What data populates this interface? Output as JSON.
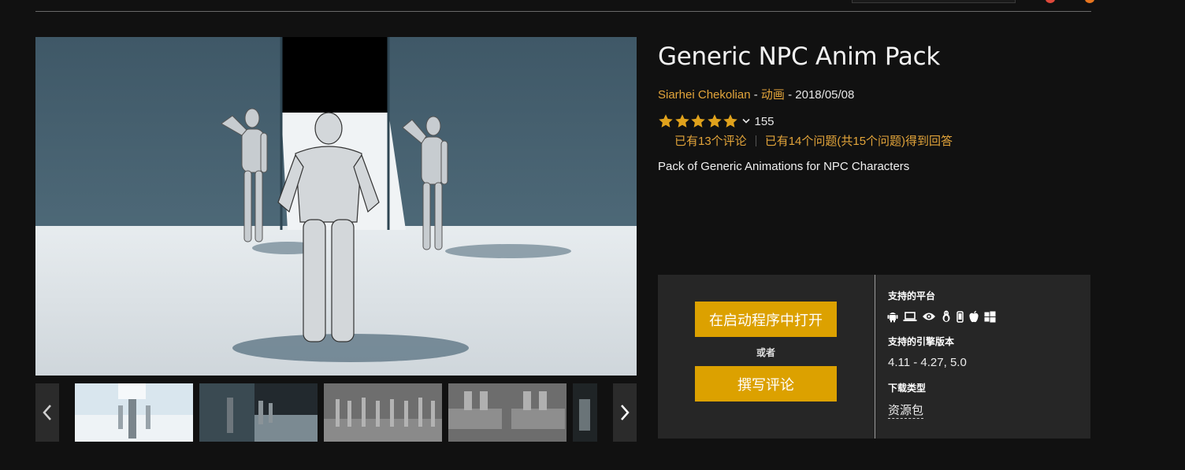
{
  "product": {
    "title": "Generic NPC Anim Pack",
    "author": "Siarhei Chekolian",
    "separator": "-",
    "category": "动画",
    "date": "2018/05/08",
    "rating_count": "155",
    "stars": 5,
    "reviews_link": "已有13个评论",
    "questions_link": "已有14个问题(共15个问题)得到回答",
    "description": "Pack of Generic Animations for NPC Characters"
  },
  "panel": {
    "open_button": "在启动程序中打开",
    "or_label": "或者",
    "review_button": "撰写评论",
    "platforms_label": "支持的平台",
    "platform_icons": [
      "android-icon",
      "laptop-icon",
      "eye-vr-icon",
      "linux-icon",
      "phone-icon",
      "apple-icon",
      "windows-icon"
    ],
    "engine_label": "支持的引擎版本",
    "engine_versions": "4.11 - 4.27, 5.0",
    "download_label": "下载类型",
    "download_type": "资源包"
  },
  "colors": {
    "accent": "#dca100",
    "link": "#e2a43a",
    "star": "#e0a21c",
    "background": "#111111",
    "panel": "#262626"
  }
}
